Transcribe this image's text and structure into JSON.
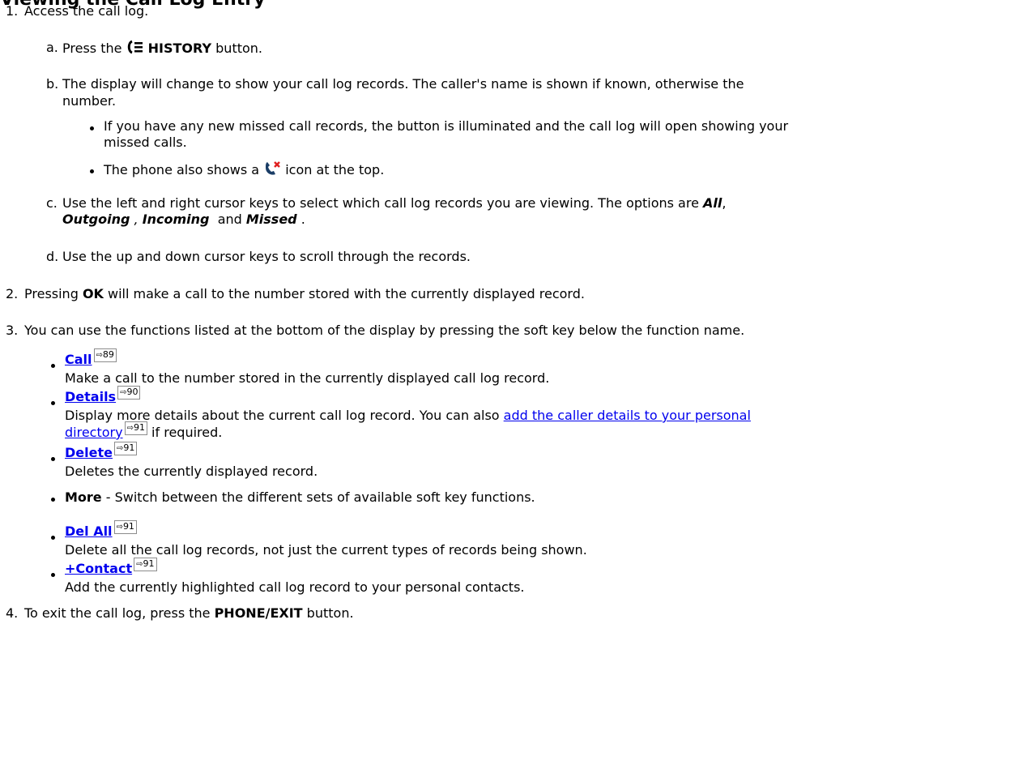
{
  "heading": "Viewing the Call Log Entry",
  "steps": [
    {
      "num": "1.",
      "text": "Access the call log."
    },
    {
      "num": "2.",
      "pre": "Pressing ",
      "bold": "OK",
      "post": " will make a call to the number stored with the currently displayed record."
    },
    {
      "num": "3.",
      "text": "You can use the functions listed at the bottom of the display by pressing the soft key below the function name."
    },
    {
      "num": "4.",
      "pre": "To exit the call log, press the ",
      "bold": "PHONE/EXIT",
      "post": " button."
    }
  ],
  "substeps": [
    {
      "letter": "a.",
      "pre": "Press the ",
      "bold": "HISTORY",
      "post": " button."
    },
    {
      "letter": "b.",
      "line1": "The display will change to show your call log records. The caller's name is shown if known, otherwise the",
      "line2": "number."
    },
    {
      "letter": "c.",
      "line1": "Use the left and right cursor keys to select which call log records you are viewing. The options are ",
      "opt_all": "All",
      "comma": ",",
      "opt_outgoing": "Outgoing",
      "sep1": " , ",
      "opt_incoming": "Incoming",
      "and": "  and ",
      "opt_missed": "Missed",
      "end": " ."
    },
    {
      "letter": "d.",
      "text": "Use the up and down cursor keys to scroll through the records."
    }
  ],
  "bullets_b": [
    {
      "line1": "If you have any new missed call records, the button is illuminated and the call log will open showing your",
      "line2": "missed calls."
    },
    {
      "pre": "The phone also shows a ",
      "post": " icon at the top."
    }
  ],
  "functions": [
    {
      "label": "Call",
      "ref": "89",
      "desc": "Make a call to the number stored in the currently displayed call log record."
    },
    {
      "label": "Details",
      "ref": "90",
      "desc_pre": "Display more details about the current call log record. You can also ",
      "desc_link1": "add the caller details to your personal",
      "desc_link2": "directory",
      "desc_ref": "91",
      "desc_post": " if required."
    },
    {
      "label": "Delete",
      "ref": "91",
      "desc": "Deletes the currently displayed record."
    },
    {
      "label": "More",
      "desc": " - Switch between the different sets of available soft key functions."
    },
    {
      "label": "Del All",
      "ref": "91",
      "desc": "Delete all the call log records, not just the current types of records being shown."
    },
    {
      "label": "+Contact",
      "ref": "91",
      "desc": "Add the currently highlighted call log record to your personal contacts."
    }
  ],
  "colors": {
    "link": "#0000ee",
    "missed_icon_red": "#e02020"
  }
}
